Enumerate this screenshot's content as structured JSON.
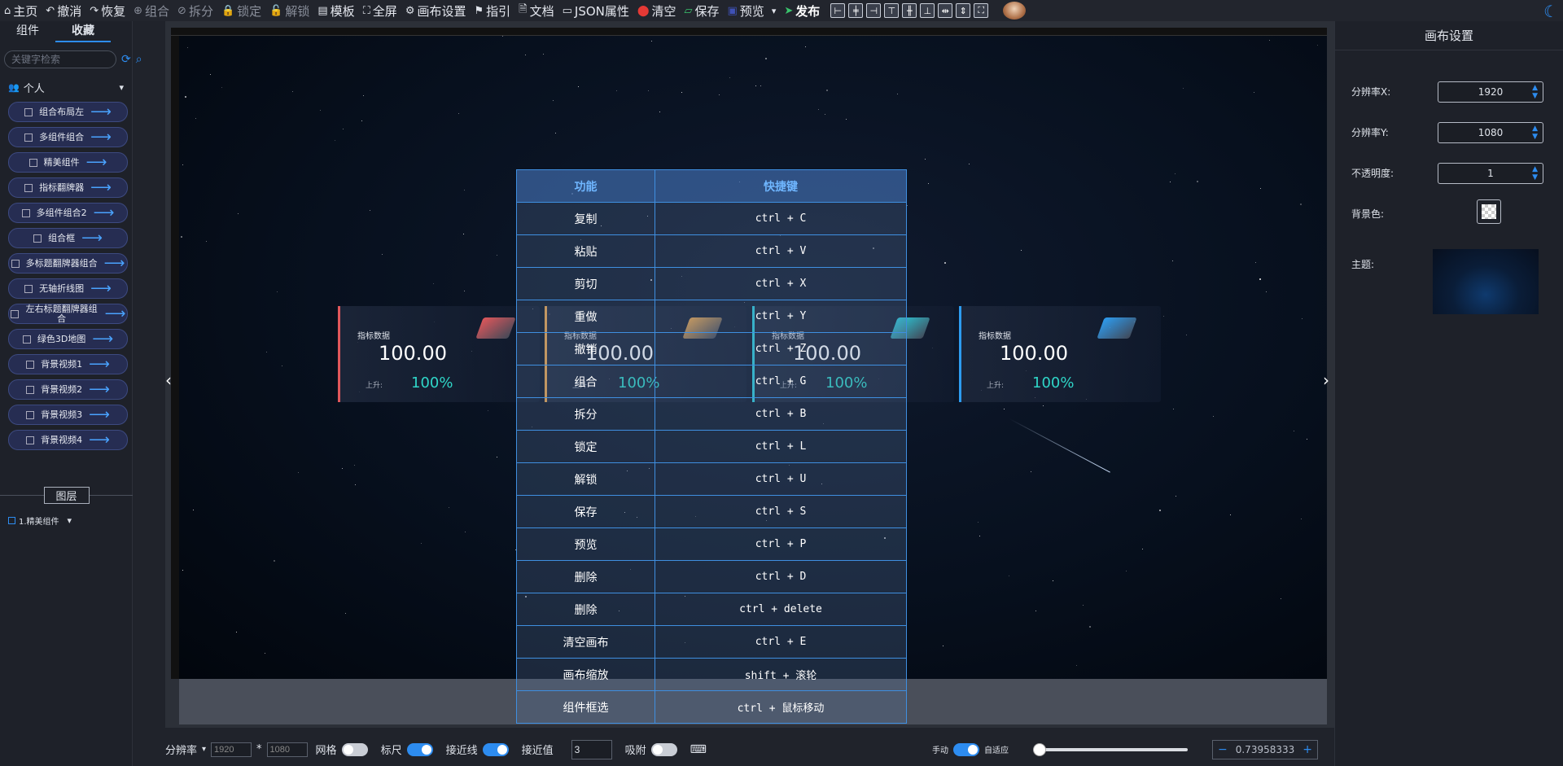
{
  "toolbar": {
    "items": [
      {
        "label": "主页",
        "icon": "home-icon",
        "dim": false
      },
      {
        "label": "撤消",
        "icon": "undo-icon",
        "dim": false
      },
      {
        "label": "恢复",
        "icon": "redo-icon",
        "dim": false
      },
      {
        "label": "组合",
        "icon": "group-icon",
        "dim": true
      },
      {
        "label": "拆分",
        "icon": "split-icon",
        "dim": true
      },
      {
        "label": "锁定",
        "icon": "lock-icon",
        "dim": true
      },
      {
        "label": "解锁",
        "icon": "unlock-icon",
        "dim": true
      },
      {
        "label": "模板",
        "icon": "template-icon",
        "dim": false
      },
      {
        "label": "全屏",
        "icon": "fullscreen-icon",
        "dim": false
      },
      {
        "label": "画布设置",
        "icon": "gear-icon",
        "dim": false
      },
      {
        "label": "指引",
        "icon": "flag-icon",
        "dim": false
      },
      {
        "label": "文档",
        "icon": "document-icon",
        "dim": false
      },
      {
        "label": "JSON属性",
        "icon": "folder-icon",
        "dim": false
      },
      {
        "label": "清空",
        "icon": "clear-icon",
        "dim": false
      },
      {
        "label": "保存",
        "icon": "save-icon",
        "dim": false
      },
      {
        "label": "预览",
        "icon": "preview-icon",
        "dim": false
      },
      {
        "label": "发布",
        "icon": "send-icon",
        "dim": false
      }
    ]
  },
  "left_panel": {
    "tabs": [
      "组件",
      "收藏"
    ],
    "search_placeholder": "关键字检索",
    "group_label": "个人",
    "favorites": [
      "组合布局左",
      "多组件组合",
      "精美组件",
      "指标翻牌器",
      "多组件组合2",
      "组合框",
      "多标题翻牌器组合",
      "无轴折线图",
      "左右标题翻牌器组合",
      "绿色3D地图",
      "背景视频1",
      "背景视频2",
      "背景视频3",
      "背景视频4"
    ],
    "layers_title": "图层",
    "layer_item": "1.精美组件"
  },
  "cards": [
    {
      "title": "指标数据",
      "value": "100.00",
      "trend": "上升:",
      "percent": "100%",
      "accent": "#e0575b"
    },
    {
      "title": "指标数据",
      "value": "100.00",
      "trend": "上升:",
      "percent": "100%",
      "accent": "#e8a34a"
    },
    {
      "title": "指标数据",
      "value": "100.00",
      "trend": "上升:",
      "percent": "100%",
      "accent": "#2bc8d8"
    },
    {
      "title": "指标数据",
      "value": "100.00",
      "trend": "上升:",
      "percent": "100%",
      "accent": "#2d9cf0"
    }
  ],
  "shortcut_table": {
    "headers": [
      "功能",
      "快捷键"
    ],
    "rows": [
      [
        "复制",
        "ctrl + C"
      ],
      [
        "粘贴",
        "ctrl + V"
      ],
      [
        "剪切",
        "ctrl + X"
      ],
      [
        "重做",
        "ctrl + Y"
      ],
      [
        "撤销",
        "ctrl + Z"
      ],
      [
        "组合",
        "ctrl + G"
      ],
      [
        "拆分",
        "ctrl + B"
      ],
      [
        "锁定",
        "ctrl + L"
      ],
      [
        "解锁",
        "ctrl + U"
      ],
      [
        "保存",
        "ctrl + S"
      ],
      [
        "预览",
        "ctrl + P"
      ],
      [
        "删除",
        "ctrl + D"
      ],
      [
        "删除",
        "ctrl + delete"
      ],
      [
        "清空画布",
        "ctrl + E"
      ],
      [
        "画布缩放",
        "shift + 滚轮"
      ],
      [
        "组件框选",
        "ctrl + 鼠标移动"
      ]
    ]
  },
  "bottom_bar": {
    "resolution_label": "分辨率",
    "res_x": "1920",
    "res_sep": "*",
    "res_y": "1080",
    "grid_label": "网格",
    "grid_on": false,
    "ruler_label": "标尺",
    "ruler_on": true,
    "snapline_label": "接近线",
    "snapline_on": true,
    "snap_value_label": "接近值",
    "snap_value": "3",
    "adsorb_label": "吸附",
    "adsorb_on": false,
    "manual_label": "手动",
    "manual_on": true,
    "auto_label": "自适应",
    "zoom_value": "0.73958333",
    "zoom_minus": "−",
    "zoom_plus": "+"
  },
  "right_panel": {
    "title": "画布设置",
    "res_x_label": "分辨率X:",
    "res_x_value": "1920",
    "res_y_label": "分辨率Y:",
    "res_y_value": "1080",
    "opacity_label": "不透明度:",
    "opacity_value": "1",
    "bgcolor_label": "背景色:",
    "theme_label": "主题:"
  },
  "colors": {
    "accent": "#2d8cf0",
    "table_border": "#3f8fe0"
  }
}
